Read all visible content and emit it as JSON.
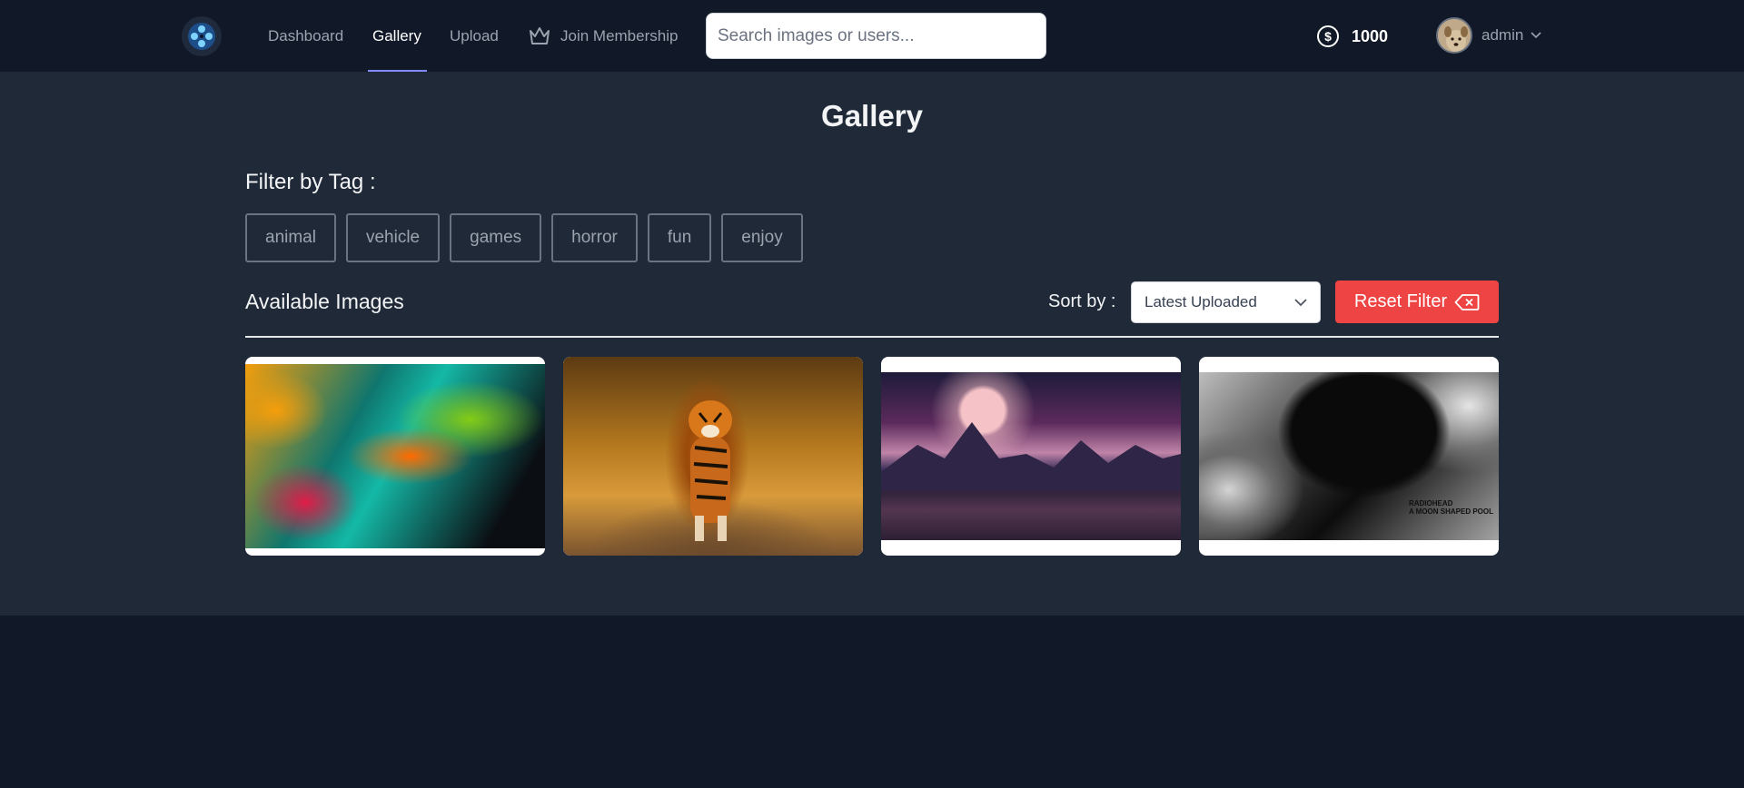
{
  "nav": {
    "logo_icon": "film-reel-logo-icon",
    "links": [
      {
        "label": "Dashboard",
        "active": false
      },
      {
        "label": "Gallery",
        "active": true
      },
      {
        "label": "Upload",
        "active": false
      },
      {
        "label": "Join Membership",
        "active": false,
        "icon": "crown-icon"
      }
    ],
    "search_placeholder": "Search images or users...",
    "coins": "1000",
    "coin_icon": "dollar-coin-icon",
    "user": "admin",
    "active_underline_color": "#818cf8"
  },
  "page": {
    "title": "Gallery",
    "filter_label": "Filter by Tag :",
    "tags": [
      "animal",
      "vehicle",
      "games",
      "horror",
      "fun",
      "enjoy"
    ],
    "available_label": "Available Images",
    "sort_label": "Sort by :",
    "sort_selected": "Latest Uploaded",
    "reset_label": "Reset Filter",
    "reset_color": "#ef4444"
  },
  "images": [
    {
      "name": "abstract paint splash"
    },
    {
      "name": "tiger walking"
    },
    {
      "name": "moon over mountains"
    },
    {
      "name": "black and white fluid art",
      "caption": "RADIOHEAD\nA MOON SHAPED POOL"
    }
  ]
}
